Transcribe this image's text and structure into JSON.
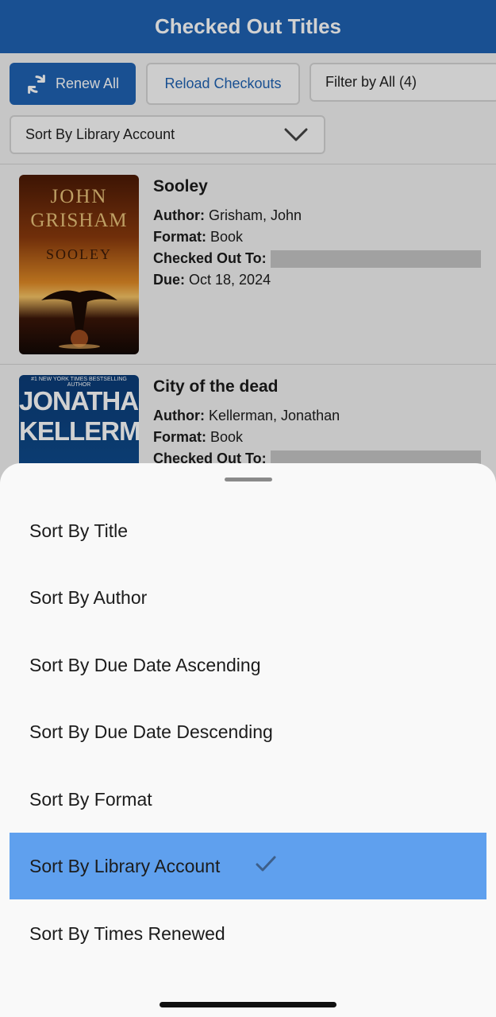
{
  "header": {
    "title": "Checked Out Titles"
  },
  "toolbar": {
    "renew_all": "Renew All",
    "reload": "Reload Checkouts",
    "filter": "Filter by All (4)",
    "sort": "Sort By Library Account"
  },
  "checkouts": [
    {
      "title": "Sooley",
      "author_label": "Author:",
      "author": "Grisham, John",
      "format_label": "Format:",
      "format": "Book",
      "checked_out_label": "Checked Out To:",
      "due_label": "Due:",
      "due": "Oct 18, 2024",
      "cover_line1": "JOHN",
      "cover_line2": "GRISHAM",
      "cover_line3": "SOOLEY"
    },
    {
      "title": "City of the dead",
      "author_label": "Author:",
      "author": "Kellerman, Jonathan",
      "format_label": "Format:",
      "format": "Book",
      "checked_out_label": "Checked Out To:",
      "cover_top": "#1 NEW YORK TIMES BESTSELLING AUTHOR",
      "cover_line1": "JONATHAN",
      "cover_line2": "KELLERMAN"
    }
  ],
  "sort_sheet": {
    "options": [
      "Sort By Title",
      "Sort By Author",
      "Sort By Due Date Ascending",
      "Sort By Due Date Descending",
      "Sort By Format",
      "Sort By Library Account",
      "Sort By Times Renewed"
    ],
    "selected": "Sort By Library Account"
  },
  "colors": {
    "primary": "#1f62b2",
    "selected": "#5fa0ee"
  }
}
